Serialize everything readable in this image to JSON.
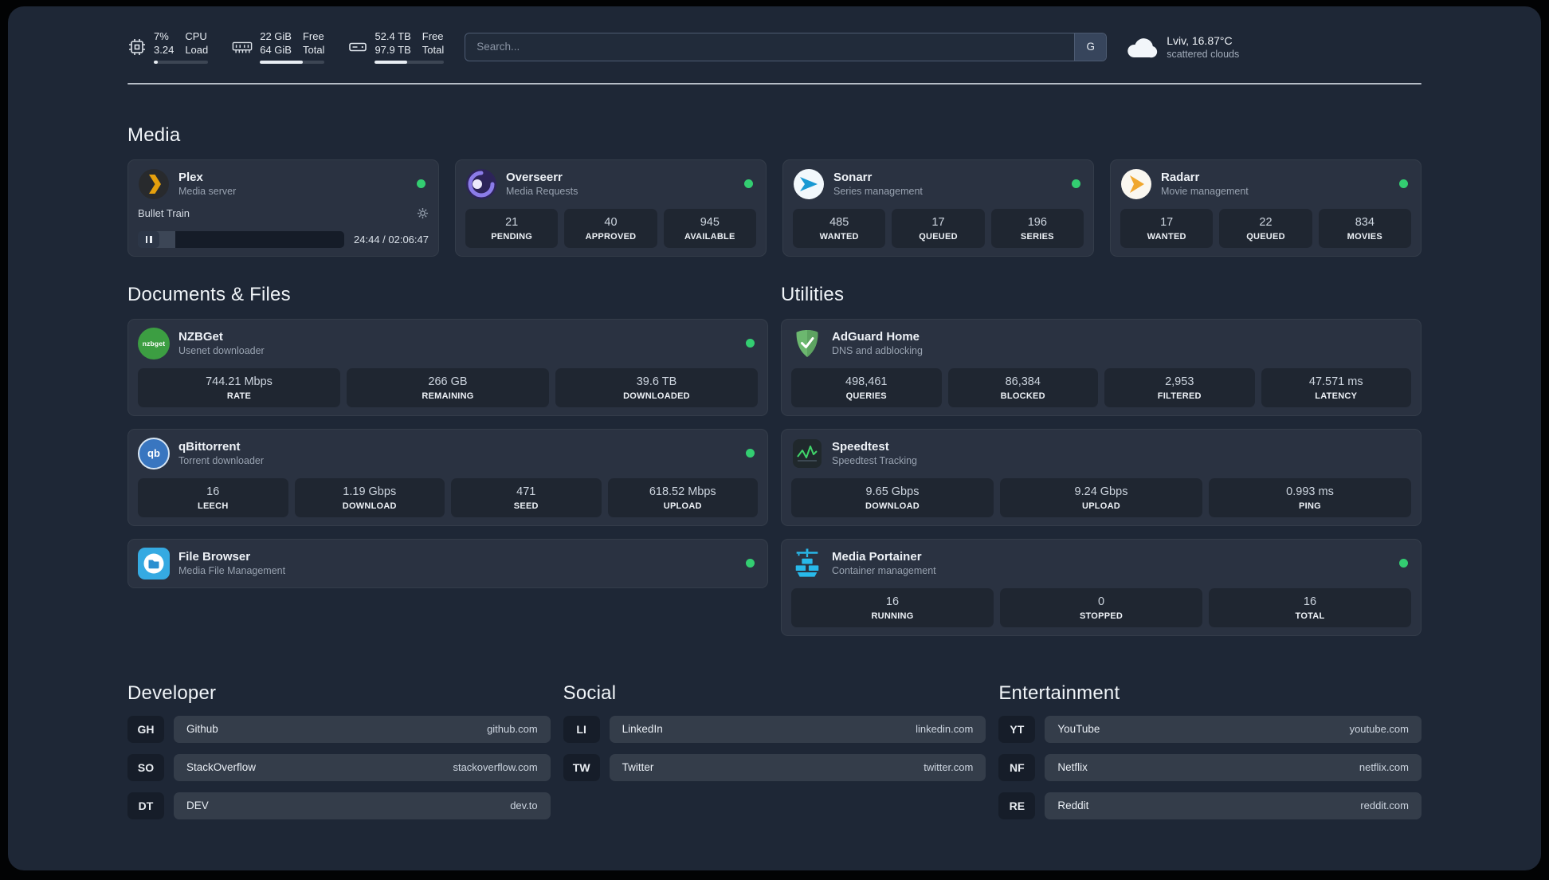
{
  "topbar": {
    "cpu": {
      "icon": "cpu-icon",
      "value_top": "7%",
      "value_bottom": "3.24",
      "label_top": "CPU",
      "label_bottom": "Load",
      "progress": 7
    },
    "memory": {
      "icon": "memory-icon",
      "value_top": "22 GiB",
      "value_bottom": "64 GiB",
      "label_top": "Free",
      "label_bottom": "Total",
      "progress": 66
    },
    "disk": {
      "icon": "disk-icon",
      "value_top": "52.4 TB",
      "value_bottom": "97.9 TB",
      "label_top": "Free",
      "label_bottom": "Total",
      "progress": 47
    },
    "search": {
      "placeholder": "Search...",
      "provider_button": "G"
    },
    "weather": {
      "icon": "cloud-icon",
      "location": "Lviv, 16.87°C",
      "condition": "scattered clouds"
    }
  },
  "media": {
    "title": "Media",
    "plex": {
      "icon": "plex-icon",
      "name": "Plex",
      "description": "Media server",
      "online": true,
      "player": {
        "track_title": "Bullet Train",
        "time": "24:44 / 02:06:47",
        "progress": 18
      }
    },
    "overseerr": {
      "icon": "overseerr-icon",
      "name": "Overseerr",
      "description": "Media Requests",
      "online": true,
      "stats": [
        {
          "value": "21",
          "label": "PENDING"
        },
        {
          "value": "40",
          "label": "APPROVED"
        },
        {
          "value": "945",
          "label": "AVAILABLE"
        }
      ]
    },
    "sonarr": {
      "icon": "sonarr-icon",
      "name": "Sonarr",
      "description": "Series management",
      "online": true,
      "stats": [
        {
          "value": "485",
          "label": "WANTED"
        },
        {
          "value": "17",
          "label": "QUEUED"
        },
        {
          "value": "196",
          "label": "SERIES"
        }
      ]
    },
    "radarr": {
      "icon": "radarr-icon",
      "name": "Radarr",
      "description": "Movie management",
      "online": true,
      "stats": [
        {
          "value": "17",
          "label": "WANTED"
        },
        {
          "value": "22",
          "label": "QUEUED"
        },
        {
          "value": "834",
          "label": "MOVIES"
        }
      ]
    }
  },
  "files": {
    "title": "Documents & Files",
    "nzbget": {
      "icon": "nzbget-icon",
      "icon_text": "nzbget",
      "name": "NZBGet",
      "description": "Usenet downloader",
      "online": true,
      "stats": [
        {
          "value": "744.21 Mbps",
          "label": "RATE"
        },
        {
          "value": "266 GB",
          "label": "REMAINING"
        },
        {
          "value": "39.6 TB",
          "label": "DOWNLOADED"
        }
      ]
    },
    "qbittorrent": {
      "icon": "qbittorrent-icon",
      "icon_text": "qb",
      "name": "qBittorrent",
      "description": "Torrent downloader",
      "online": true,
      "stats": [
        {
          "value": "16",
          "label": "LEECH"
        },
        {
          "value": "1.19 Gbps",
          "label": "DOWNLOAD"
        },
        {
          "value": "471",
          "label": "SEED"
        },
        {
          "value": "618.52 Mbps",
          "label": "UPLOAD"
        }
      ]
    },
    "filebrowser": {
      "icon": "filebrowser-icon",
      "name": "File Browser",
      "description": "Media File Management",
      "online": true
    }
  },
  "utilities": {
    "title": "Utilities",
    "adguard": {
      "icon": "adguard-shield-icon",
      "name": "AdGuard Home",
      "description": "DNS and adblocking",
      "stats": [
        {
          "value": "498,461",
          "label": "QUERIES"
        },
        {
          "value": "86,384",
          "label": "BLOCKED"
        },
        {
          "value": "2,953",
          "label": "FILTERED"
        },
        {
          "value": "47.571 ms",
          "label": "LATENCY"
        }
      ]
    },
    "speedtest": {
      "icon": "speedtest-graph-icon",
      "name": "Speedtest",
      "description": "Speedtest Tracking",
      "stats": [
        {
          "value": "9.65 Gbps",
          "label": "DOWNLOAD"
        },
        {
          "value": "9.24 Gbps",
          "label": "UPLOAD"
        },
        {
          "value": "0.993 ms",
          "label": "PING"
        }
      ]
    },
    "portainer": {
      "icon": "portainer-crane-icon",
      "name": "Media Portainer",
      "description": "Container management",
      "online": true,
      "stats": [
        {
          "value": "16",
          "label": "RUNNING"
        },
        {
          "value": "0",
          "label": "STOPPED"
        },
        {
          "value": "16",
          "label": "TOTAL"
        }
      ]
    }
  },
  "bookmarks": {
    "developer": {
      "title": "Developer",
      "items": [
        {
          "abbr": "GH",
          "name": "Github",
          "url": "github.com"
        },
        {
          "abbr": "SO",
          "name": "StackOverflow",
          "url": "stackoverflow.com"
        },
        {
          "abbr": "DT",
          "name": "DEV",
          "url": "dev.to"
        }
      ]
    },
    "social": {
      "title": "Social",
      "items": [
        {
          "abbr": "LI",
          "name": "LinkedIn",
          "url": "linkedin.com"
        },
        {
          "abbr": "TW",
          "name": "Twitter",
          "url": "twitter.com"
        }
      ]
    },
    "entertainment": {
      "title": "Entertainment",
      "items": [
        {
          "abbr": "YT",
          "name": "YouTube",
          "url": "youtube.com"
        },
        {
          "abbr": "NF",
          "name": "Netflix",
          "url": "netflix.com"
        },
        {
          "abbr": "RE",
          "name": "Reddit",
          "url": "reddit.com"
        }
      ]
    }
  }
}
